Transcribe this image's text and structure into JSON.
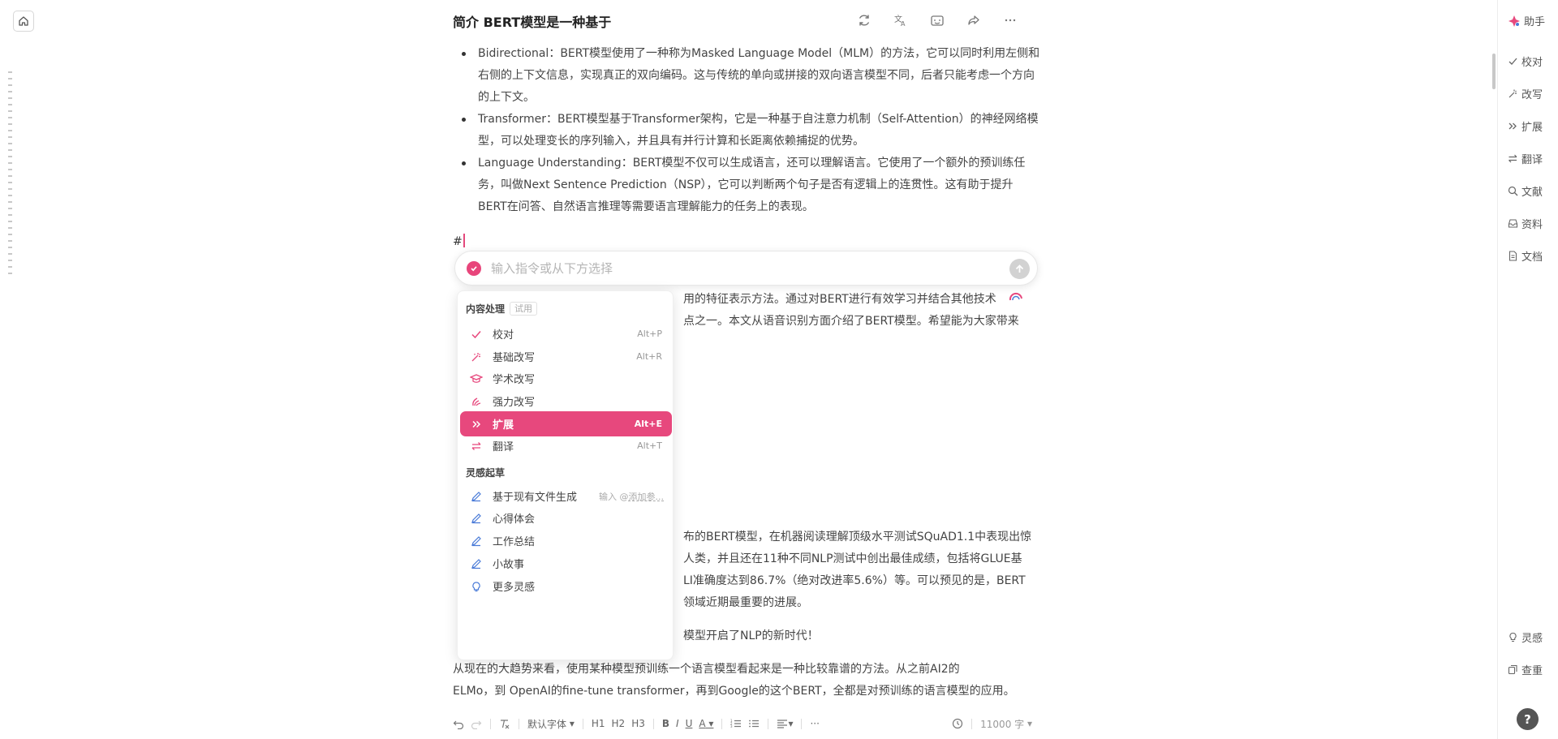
{
  "colors": {
    "accent": "#e7487d",
    "text": "#444444",
    "muted": "#999999"
  },
  "document": {
    "title": "简介 BERT模型是一种基于",
    "bullets": [
      "Bidirectional：BERT模型使用了一种称为Masked Language Model（MLM）的方法，它可以同时利用左侧和右侧的上下文信息，实现真正的双向编码。这与传统的单向或拼接的双向语言模型不同，后者只能考虑一个方向的上下文。",
      "Transformer：BERT模型基于Transformer架构，它是一种基于自注意力机制（Self-Attention）的神经网络模型，可以处理变长的序列输入，并且具有并行计算和长距离依赖捕捉的优势。",
      "Language Understanding：BERT模型不仅可以生成语言，还可以理解语言。它使用了一个额外的预训练任务，叫做Next Sentence Prediction（NSP），它可以判断两个句子是否有逻辑上的连贯性。这有助于提升BERT在问答、自然语言推理等需要语言理解能力的任务上的表现。"
    ],
    "heading_marker": "#",
    "partial_para1_line1": "用的特征表示方法。通过对BERT进行有效学习并结合其他技术",
    "partial_para1_line2": "点之一。本文从语音识别方面介绍了BERT模型。希望能为大家带来",
    "partial_para2_line1": "布的BERT模型，在机器阅读理解顶级水平测试SQuAD1.1中表现出惊",
    "partial_para2_line2": "人类，并且还在11种不同NLP测试中创出最佳成绩，包括将GLUE基",
    "partial_para2_line3": "LI准确度达到86.7%（绝对改进率5.6%）等。可以预见的是，BERT",
    "partial_para2_line4": "领域近期最重要的进展。",
    "partial_para3": "模型开启了NLP的新时代！",
    "para4_line1": "从现在的大趋势来看，使用某种模型预训练一个语言模型看起来是一种比较靠谱的方法。从之前AI2的",
    "para4_line2": "ELMo，到 OpenAI的fine-tune transformer，再到Google的这个BERT，全都是对预训练的语言模型的应用。"
  },
  "command": {
    "placeholder": "输入指令或从下方选择",
    "value": ""
  },
  "menu": {
    "section1": {
      "title": "内容处理",
      "badge": "试用"
    },
    "items1": [
      {
        "label": "校对",
        "shortcut": "Alt+P",
        "icon": "check-icon"
      },
      {
        "label": "基础改写",
        "shortcut": "Alt+R",
        "icon": "sparkle-rewrite-icon"
      },
      {
        "label": "学术改写",
        "shortcut": "",
        "icon": "graduation-cap-icon"
      },
      {
        "label": "强力改写",
        "shortcut": "",
        "icon": "power-rewrite-icon"
      },
      {
        "label": "扩展",
        "shortcut": "Alt+E",
        "icon": "double-chevron-right-icon"
      },
      {
        "label": "翻译",
        "shortcut": "Alt+T",
        "icon": "swap-arrows-icon"
      }
    ],
    "section2": {
      "title": "灵感起草"
    },
    "items2": [
      {
        "label": "基于现有文件生成",
        "hint_prefix": "输入 @",
        "hint_link": "添加参...",
        "icon": "pen-icon"
      },
      {
        "label": "心得体会",
        "icon": "pen-icon"
      },
      {
        "label": "工作总结",
        "icon": "pen-icon"
      },
      {
        "label": "小故事",
        "icon": "pen-icon"
      },
      {
        "label": "更多灵感",
        "icon": "lightbulb-icon"
      }
    ]
  },
  "toolbar": {
    "font": "默认字体",
    "h1": "H1",
    "h2": "H2",
    "h3": "H3",
    "bold": "B",
    "italic": "I",
    "underline": "U",
    "color": "A",
    "word_count": "11000 字"
  },
  "right_panel": {
    "assistant": "助手",
    "tools": [
      "校对",
      "改写",
      "扩展",
      "翻译",
      "文献",
      "资料",
      "文档"
    ],
    "bottom": [
      "灵感",
      "查重"
    ],
    "help": "?"
  }
}
